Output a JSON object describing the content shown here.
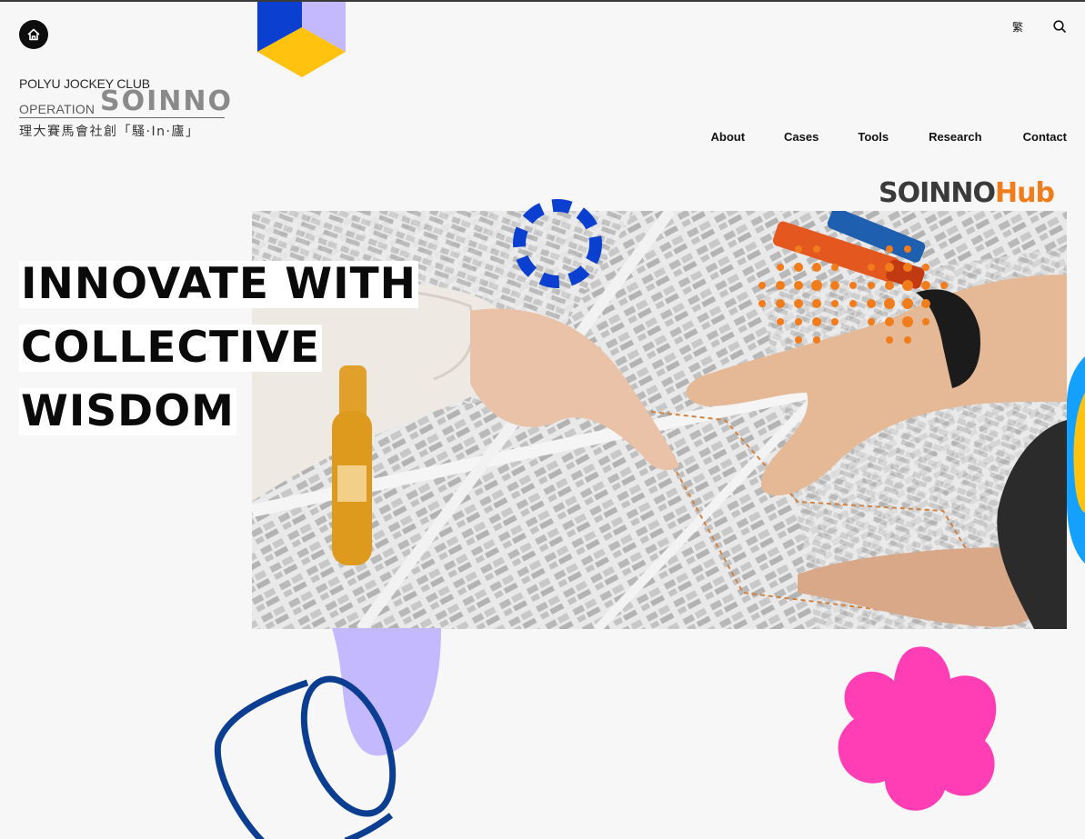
{
  "header": {
    "home_icon": "home-icon",
    "lang_label": "繁",
    "search_icon": "search-icon"
  },
  "logo": {
    "line1": "POLYU JOCKEY CLUB",
    "line2_prefix": "OPERATION",
    "brand": "SOINNO",
    "chinese": "理大賽馬會社創「騷·In·廬」"
  },
  "nav": {
    "items": [
      {
        "label": "About"
      },
      {
        "label": "Cases"
      },
      {
        "label": "Tools"
      },
      {
        "label": "Research"
      },
      {
        "label": "Contact"
      }
    ]
  },
  "hub": {
    "part1": "SOINNO",
    "part2": "Hub"
  },
  "hero": {
    "headline_lines": [
      "INNOVATE WITH",
      "COLLECTIVE",
      "WISDOM"
    ]
  },
  "colors": {
    "accent_orange": "#f07c1c",
    "blue": "#0a3fd0",
    "navy": "#0b3d91",
    "lavender": "#c4b8ff",
    "yellow": "#ffc20e",
    "pink": "#ff3db4",
    "sky": "#14a0ff"
  }
}
